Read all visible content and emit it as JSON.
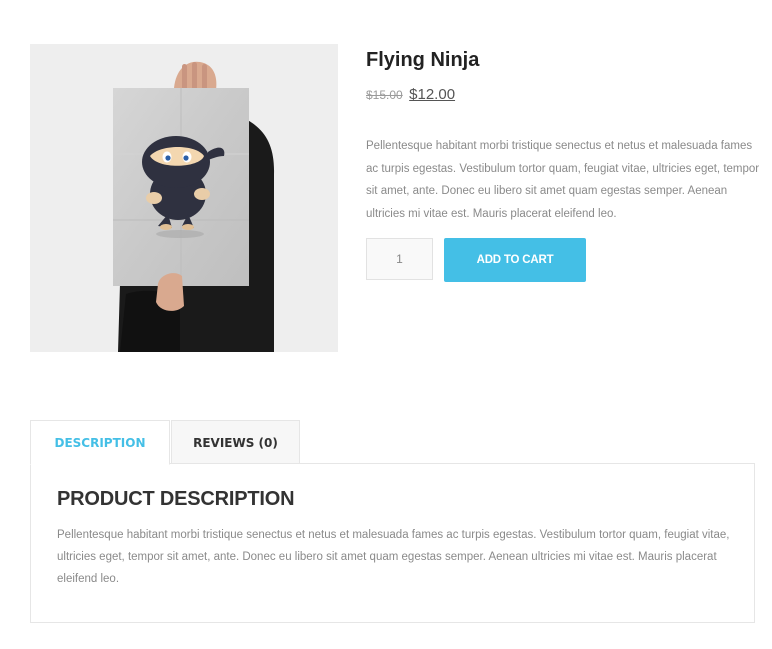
{
  "product": {
    "title": "Flying Ninja",
    "price_old": "$15.00",
    "price_new": "$12.00",
    "short_description": "Pellentesque habitant morbi tristique senectus et netus et malesuada fames ac turpis egestas. Vestibulum tortor quam, feugiat vitae, ultricies eget, tempor sit amet, ante. Donec eu libero sit amet quam egestas semper. Aenean ultricies mi vitae est. Mauris placerat eleifend leo.",
    "quantity": "1",
    "add_to_cart_label": "ADD TO CART",
    "image_icon": "ninja-poster-image"
  },
  "tabs": [
    {
      "label": "DESCRIPTION",
      "active": true
    },
    {
      "label": "REVIEWS (0)",
      "active": false
    }
  ],
  "description_panel": {
    "heading": "PRODUCT DESCRIPTION",
    "text": "Pellentesque habitant morbi tristique senectus et netus et malesuada fames ac turpis egestas. Vestibulum tortor quam, feugiat vitae, ultricies eget, tempor sit amet, ante. Donec eu libero sit amet quam egestas semper. Aenean ultricies mi vitae est. Mauris placerat eleifend leo."
  },
  "colors": {
    "accent": "#44bfe6",
    "text_muted": "#8a8a8a",
    "image_bg": "#eeeeee"
  }
}
